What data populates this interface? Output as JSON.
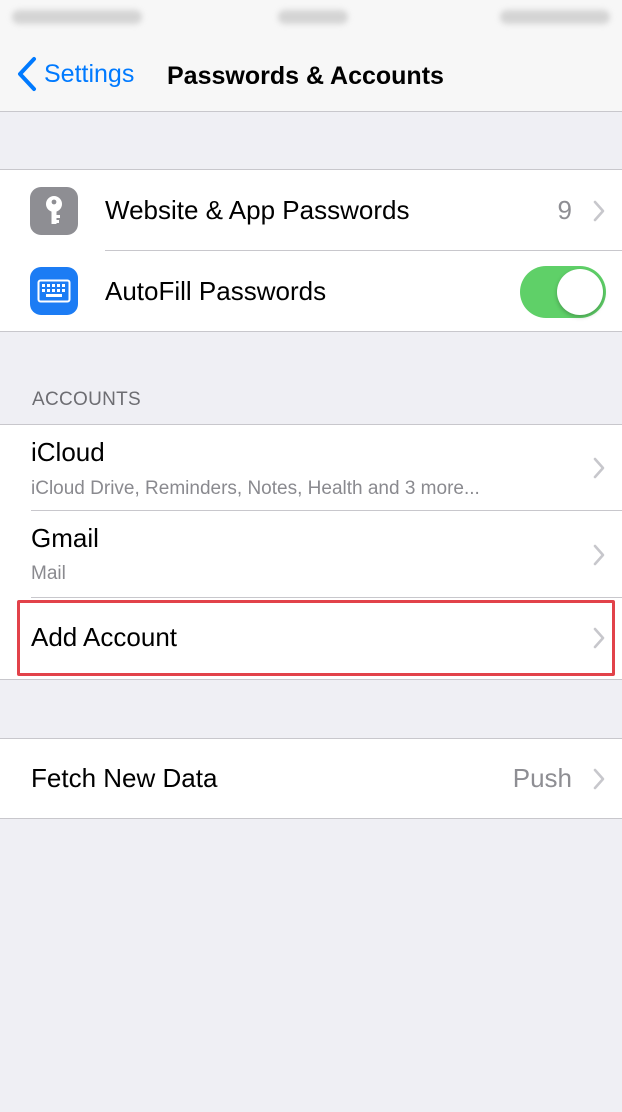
{
  "nav": {
    "back_label": "Settings",
    "title": "Passwords & Accounts"
  },
  "passwords_group": {
    "items": [
      {
        "label": "Website & App Passwords",
        "value": "9",
        "icon": "key-icon"
      },
      {
        "label": "AutoFill Passwords",
        "icon": "keyboard-icon",
        "toggle_on": true
      }
    ]
  },
  "accounts_section": {
    "header": "ACCOUNTS",
    "items": [
      {
        "label": "iCloud",
        "subtitle": "iCloud Drive, Reminders, Notes, Health and 3 more..."
      },
      {
        "label": "Gmail",
        "subtitle": "Mail"
      },
      {
        "label": "Add Account"
      }
    ]
  },
  "fetch_group": {
    "label": "Fetch New Data",
    "value": "Push"
  },
  "colors": {
    "accent": "#007aff",
    "toggle_on": "#5fd068",
    "highlight": "#e2424a",
    "background": "#efeff4"
  }
}
